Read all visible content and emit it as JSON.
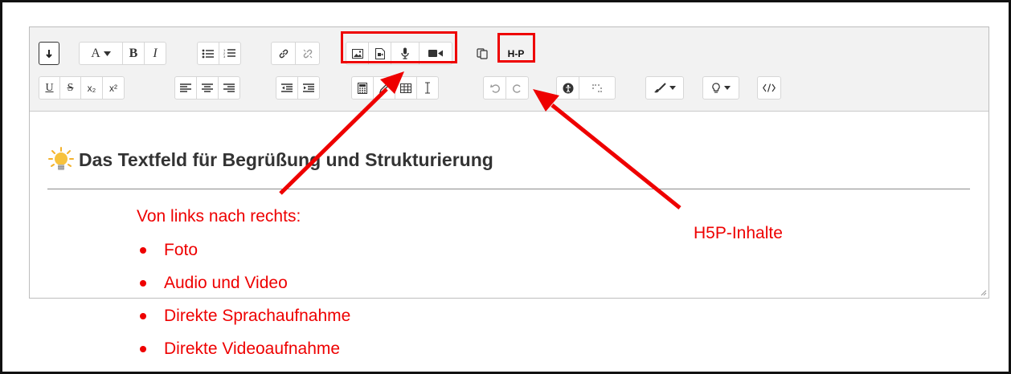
{
  "toolbar": {
    "row1": {
      "font_size_label": "A",
      "bold_label": "B",
      "italic_label": "I",
      "h5p_label": "H-P"
    },
    "row2": {
      "underline_label": "U",
      "strike_label": "S",
      "subscript_label": "x₂",
      "superscript_label": "x²"
    }
  },
  "content": {
    "heading": "Das Textfeld für Begrüßung und Strukturierung"
  },
  "annotations": {
    "list_title": "Von links nach rechts:",
    "items": [
      "Foto",
      "Audio und Video",
      "Direkte Sprachaufnahme",
      "Direkte Videoaufnahme"
    ],
    "h5p_label": "H5P-Inhalte",
    "color": "#e00000"
  }
}
